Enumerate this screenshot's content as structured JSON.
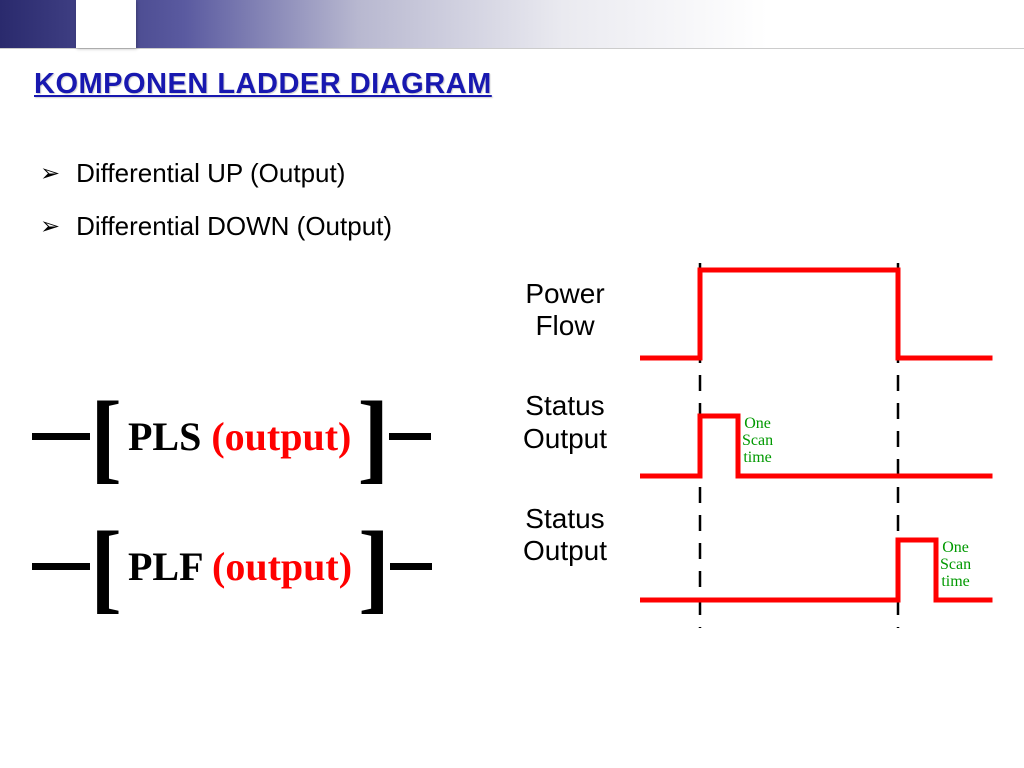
{
  "title": "KOMPONEN LADDER DIAGRAM",
  "bullets": {
    "b1": "Differential UP (Output)",
    "b2": "Differential DOWN (Output)"
  },
  "ladder": {
    "pls_black": "PLS",
    "pls_red": " (output)",
    "plf_black": "PLF",
    "plf_red": " (output)"
  },
  "timing": {
    "power_flow": "Power Flow",
    "status_output_1": "Status Output",
    "status_output_2": "Status Output"
  },
  "scan": {
    "l1": "One",
    "l2": "Scan",
    "l3": "time"
  },
  "colors": {
    "accent_blue": "#1818b0",
    "signal_red": "#ff0000",
    "scan_green": "#009900"
  }
}
